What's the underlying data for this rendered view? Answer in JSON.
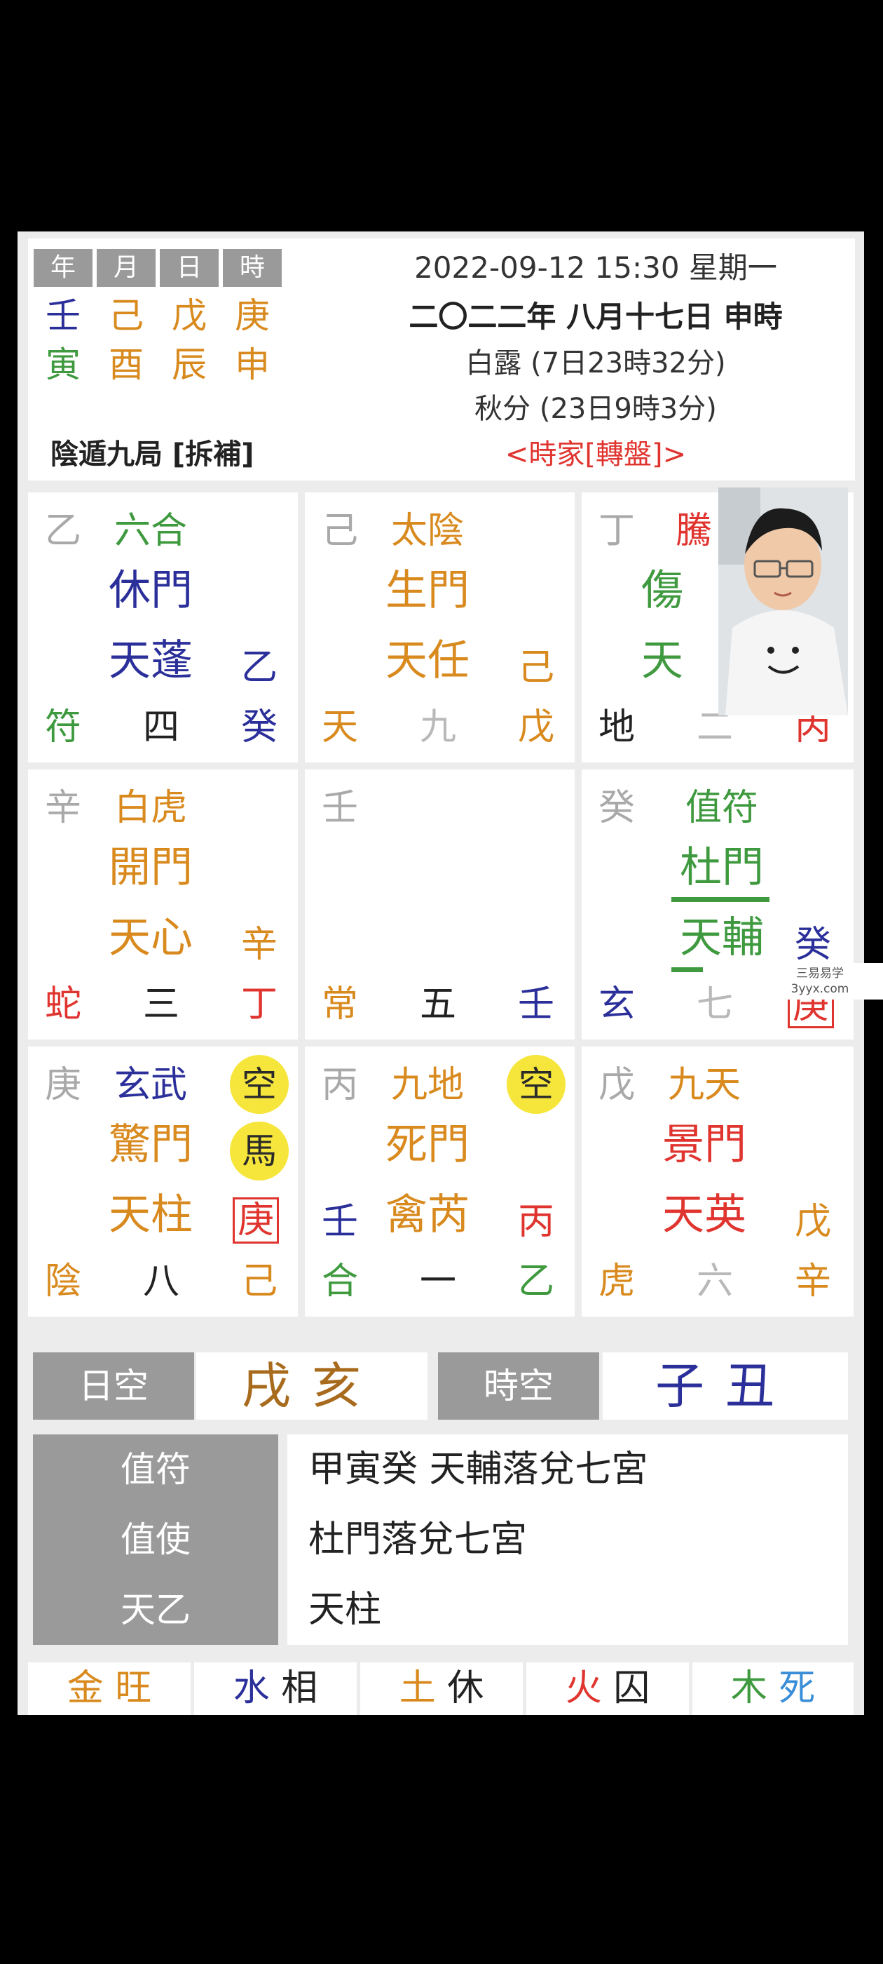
{
  "header": {
    "pillar_labels": [
      "年",
      "月",
      "日",
      "時"
    ],
    "stems": [
      "壬",
      "己",
      "戊",
      "庚"
    ],
    "branches": [
      "寅",
      "酉",
      "辰",
      "申"
    ],
    "datetime": "2022-09-12 15:30 星期一",
    "lunar": "二〇二二年 八月十七日 申時",
    "term1": "白露 (7日23時32分)",
    "term2": "秋分 (23日9時3分)",
    "ju": "陰遁九局 [拆補]",
    "method": "<時家[轉盤]>"
  },
  "palaces": {
    "p4": {
      "tl": "乙",
      "god": "六合",
      "door": "休門",
      "star": "天蓬",
      "star_stem": "乙",
      "bl": "符",
      "num": "四",
      "br": "癸"
    },
    "p9": {
      "tl": "己",
      "god": "太陰",
      "door": "生門",
      "star": "天任",
      "star_stem": "己",
      "bl": "天",
      "num": "九",
      "br": "戊"
    },
    "p2": {
      "tl": "丁",
      "god": "騰",
      "door": "傷",
      "star": "天",
      "bl": "地",
      "num": "二",
      "br": "丙"
    },
    "p3": {
      "tl": "辛",
      "god": "白虎",
      "door": "開門",
      "star": "天心",
      "star_stem": "辛",
      "bl": "蛇",
      "num": "三",
      "br": "丁"
    },
    "p5": {
      "tl": "壬",
      "bl": "常",
      "num": "五",
      "br": "壬"
    },
    "p7": {
      "tl": "癸",
      "god": "值符",
      "door": "杜門",
      "star": "天輔",
      "star_stem": "癸",
      "bl": "玄",
      "num": "七",
      "br": "庚"
    },
    "p8": {
      "tl": "庚",
      "god": "玄武",
      "door": "驚門",
      "star": "天柱",
      "star_stem": "庚",
      "empty": "空",
      "horse": "馬",
      "bl": "陰",
      "num": "八",
      "br": "己"
    },
    "p1": {
      "tl": "丙",
      "god": "九地",
      "door": "死門",
      "star": "禽芮",
      "star_stem": "丙",
      "left_stem": "壬",
      "empty": "空",
      "bl": "合",
      "num": "一",
      "br": "乙"
    },
    "p6": {
      "tl": "戊",
      "god": "九天",
      "door": "景門",
      "star": "天英",
      "star_stem": "戊",
      "bl": "虎",
      "num": "六",
      "br": "辛"
    }
  },
  "void": {
    "day_label": "日空",
    "day_value": "戌亥",
    "hour_label": "時空",
    "hour_value": "子丑"
  },
  "info": [
    {
      "label": "值符",
      "value": "甲寅癸  天輔落兌七宮"
    },
    {
      "label": "值使",
      "value": "杜門落兌七宮"
    },
    {
      "label": "天乙",
      "value": "天柱"
    }
  ],
  "status": [
    {
      "el": "金",
      "state": "旺"
    },
    {
      "el": "水",
      "state": "相"
    },
    {
      "el": "土",
      "state": "休"
    },
    {
      "el": "火",
      "state": "囚"
    },
    {
      "el": "木",
      "state": "死"
    }
  ],
  "watermark": {
    "line1": "三易易学",
    "line2": "3yyx.com"
  },
  "colors": {
    "gray_label": "#9a9a9a",
    "empty_badge": "#f6e63c",
    "green": "#3f9a3f",
    "orange": "#d98a1e",
    "navy": "#2b2f9a",
    "red": "#e0342f"
  }
}
